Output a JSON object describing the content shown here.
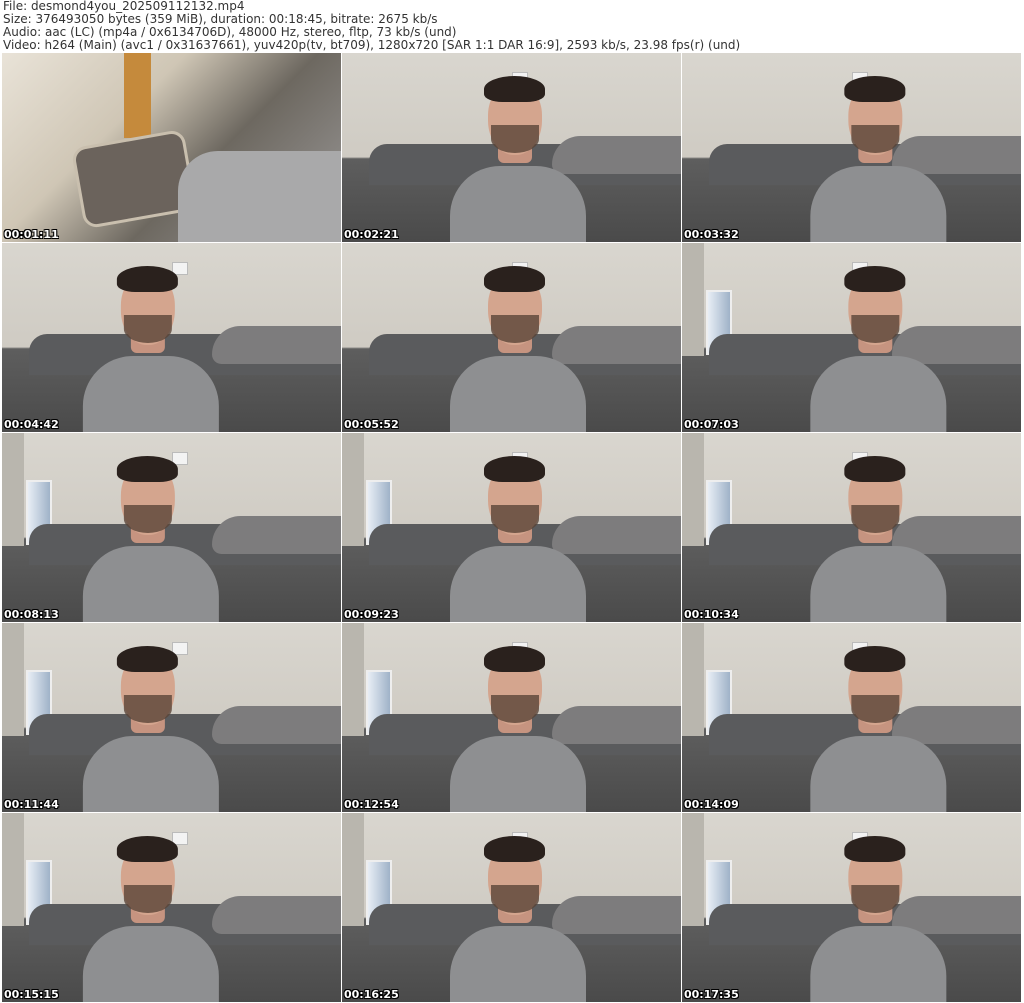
{
  "header": {
    "file": "File: desmond4you_202509112132.mp4",
    "size": "Size: 376493050 bytes (359 MiB), duration: 00:18:45, bitrate: 2675 kb/s",
    "audio": "Audio: aac (LC) (mp4a / 0x6134706D), 48000 Hz, stereo, fltp, 73 kb/s (und)",
    "video": "Video: h264 (Main) (avc1 / 0x31637661), yuv420p(tv, bt709), 1280x720 [SAR 1:1 DAR 16:9], 2593 kb/s, 23.98 fps(r) (und)"
  },
  "thumbnails": [
    {
      "timestamp": "00:01:11"
    },
    {
      "timestamp": "00:02:21"
    },
    {
      "timestamp": "00:03:32"
    },
    {
      "timestamp": "00:04:42"
    },
    {
      "timestamp": "00:05:52"
    },
    {
      "timestamp": "00:07:03"
    },
    {
      "timestamp": "00:08:13"
    },
    {
      "timestamp": "00:09:23"
    },
    {
      "timestamp": "00:10:34"
    },
    {
      "timestamp": "00:11:44"
    },
    {
      "timestamp": "00:12:54"
    },
    {
      "timestamp": "00:14:09"
    },
    {
      "timestamp": "00:15:15"
    },
    {
      "timestamp": "00:16:25"
    },
    {
      "timestamp": "00:17:35"
    }
  ]
}
